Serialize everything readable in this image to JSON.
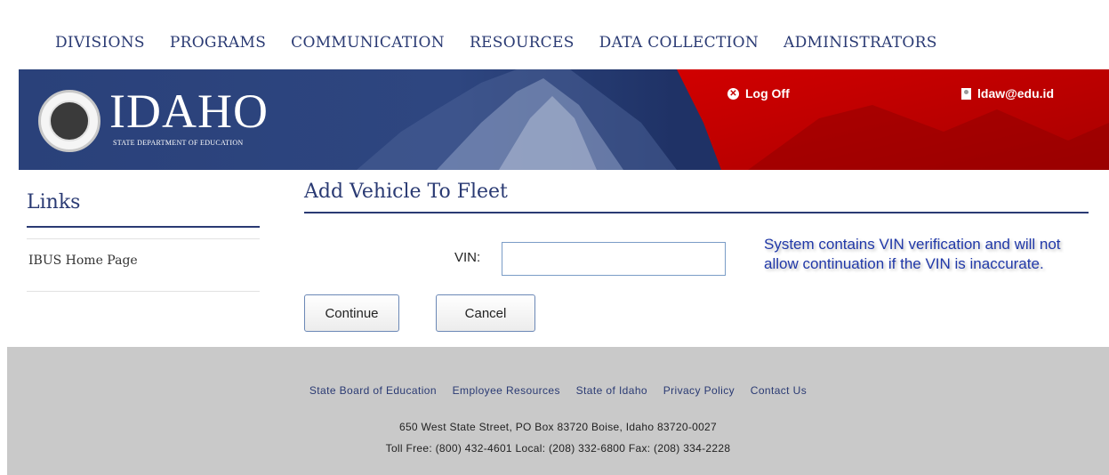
{
  "nav": {
    "items": [
      "DIVISIONS",
      "PROGRAMS",
      "COMMUNICATION",
      "RESOURCES",
      "DATA COLLECTION",
      "ADMINISTRATORS"
    ]
  },
  "banner": {
    "logo_text": "IDAHO",
    "logo_subtitle": "STATE DEPARTMENT OF EDUCATION",
    "logoff_label": "Log Off",
    "user_label": "ldaw@edu.id",
    "colors": {
      "blue": "#23386e",
      "red": "#c00000"
    }
  },
  "sidebar": {
    "title": "Links",
    "items": [
      {
        "label": "IBUS Home Page"
      }
    ]
  },
  "main": {
    "title": "Add Vehicle To Fleet",
    "vin_label": "VIN:",
    "vin_value": "",
    "continue_label": "Continue",
    "cancel_label": "Cancel",
    "note": "System contains VIN verification and will not allow continuation if the VIN is inaccurate."
  },
  "footer": {
    "links": [
      "State Board of Education",
      "Employee Resources",
      "State of Idaho",
      "Privacy Policy",
      "Contact Us"
    ],
    "address": "650 West State Street, PO Box 83720 Boise, Idaho 83720-0027",
    "phone": "Toll Free: (800) 432-4601 Local: (208) 332-6800 Fax: (208) 334-2228"
  }
}
